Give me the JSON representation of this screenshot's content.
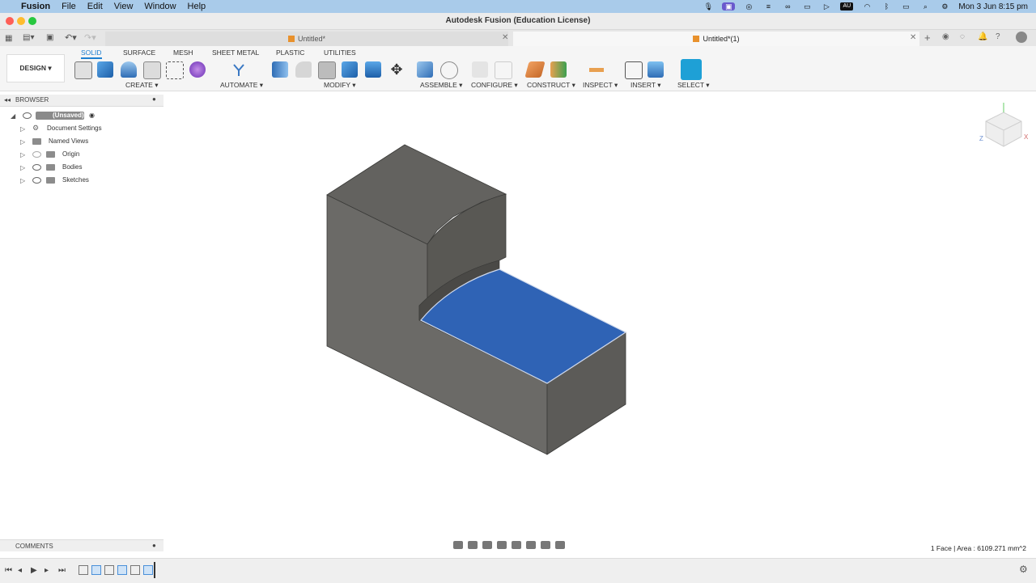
{
  "menubar": {
    "app_name": "Fusion",
    "menus": [
      "File",
      "Edit",
      "View",
      "Window",
      "Help"
    ],
    "clock": "Mon 3 Jun  8:15 pm",
    "au_badge": "AU"
  },
  "window": {
    "title": "Autodesk Fusion (Education License)"
  },
  "tabs": [
    {
      "label": "Untitled*"
    },
    {
      "label": "Untitled*(1)"
    }
  ],
  "toolbar": {
    "workspace": "DESIGN ▾",
    "workspace_tabs": [
      "SOLID",
      "SURFACE",
      "MESH",
      "SHEET METAL",
      "PLASTIC",
      "UTILITIES"
    ],
    "groups": {
      "create": "CREATE ▾",
      "automate": "AUTOMATE ▾",
      "modify": "MODIFY ▾",
      "assemble": "ASSEMBLE ▾",
      "configure": "CONFIGURE ▾",
      "construct": "CONSTRUCT ▾",
      "inspect": "INSPECT ▾",
      "insert": "INSERT ▾",
      "select": "SELECT ▾"
    },
    "accent": "#1e7fd0"
  },
  "browser": {
    "header": "BROWSER",
    "root": "(Unsaved)",
    "items": [
      "Document Settings",
      "Named Views",
      "Origin",
      "Bodies",
      "Sketches"
    ]
  },
  "comments": {
    "label": "COMMENTS"
  },
  "status": {
    "text": "1 Face | Area : 6109.271 mm^2"
  },
  "model": {
    "body_color": "#6b6a67",
    "selected_face_color": "#2f63b5"
  },
  "viewcube": {
    "x_label": "X",
    "z_label": "Z"
  }
}
